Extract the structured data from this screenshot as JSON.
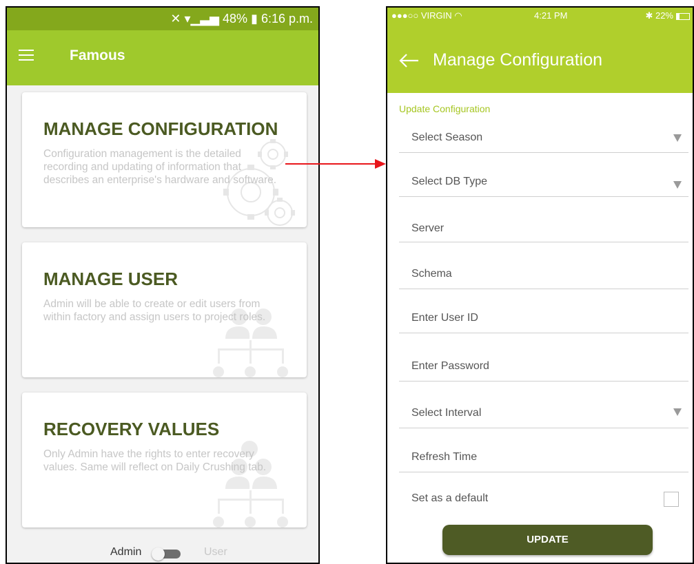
{
  "left_screen": {
    "status_bar": {
      "text": "✕ ▾▁▃▅ 48% ▮ 6:16 p.m."
    },
    "app_bar": {
      "title": "Famous",
      "menu_icon": "hamburger-menu-icon"
    },
    "cards": [
      {
        "title": "MANAGE CONFIGURATION",
        "description": "Configuration management is the detailed recording and updating of information that describes an enterprise's hardware and software.",
        "icon": "gears-icon"
      },
      {
        "title": "MANAGE USER",
        "description": "Admin will be able to create or edit users from within factory and assign users to project roles.",
        "icon": "user-hierarchy-icon"
      },
      {
        "title": "RECOVERY VALUES",
        "description": "Only Admin have the rights to enter recovery values. Same will reflect on Daily Crushing tab.",
        "icon": "user-hierarchy-icon"
      }
    ],
    "toggle": {
      "left_label": "Admin",
      "right_label": "User",
      "state": "Admin"
    }
  },
  "right_screen": {
    "status_bar": {
      "carrier": "●●●○○ VIRGIN ◠",
      "time": "4:21 PM",
      "battery": "✱ 22%"
    },
    "header": {
      "title": "Manage Configuration",
      "back_icon": "back-arrow-icon"
    },
    "section_label": "Update Configuration",
    "fields": [
      {
        "label": "Select Season",
        "type": "dropdown"
      },
      {
        "label": "Select DB Type",
        "type": "dropdown"
      },
      {
        "label": "Server",
        "type": "text"
      },
      {
        "label": "Schema",
        "type": "text"
      },
      {
        "label": "Enter User ID",
        "type": "text"
      },
      {
        "label": "Enter Password",
        "type": "password"
      },
      {
        "label": "Select Interval",
        "type": "dropdown"
      },
      {
        "label": "Refresh Time",
        "type": "text"
      }
    ],
    "default_checkbox": {
      "label": "Set as a default",
      "checked": false
    },
    "update_button": "UPDATE"
  },
  "colors": {
    "left_status": "#84a81c",
    "left_appbar": "#9fc92c",
    "right_header": "#b0cf2c",
    "accent_label": "#a6c622",
    "card_title": "#4b5a22",
    "button": "#4e5b25",
    "arrow": "#e8161b"
  }
}
